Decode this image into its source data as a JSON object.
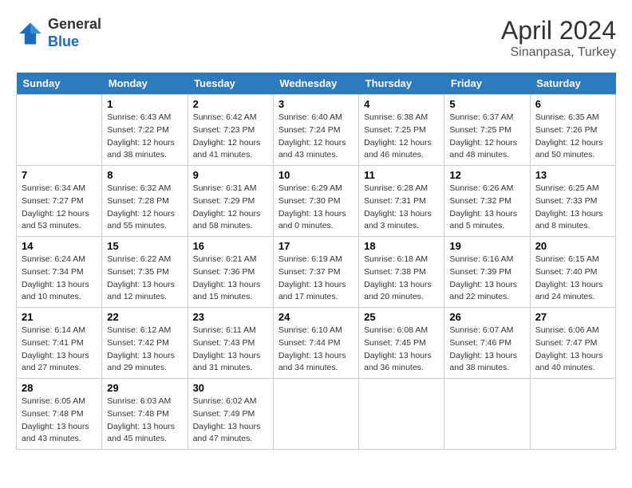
{
  "header": {
    "logo_line1": "General",
    "logo_line2": "Blue",
    "month_year": "April 2024",
    "location": "Sinanpasa, Turkey"
  },
  "days_of_week": [
    "Sunday",
    "Monday",
    "Tuesday",
    "Wednesday",
    "Thursday",
    "Friday",
    "Saturday"
  ],
  "weeks": [
    [
      {
        "day": "",
        "info": ""
      },
      {
        "day": "1",
        "info": "Sunrise: 6:43 AM\nSunset: 7:22 PM\nDaylight: 12 hours\nand 38 minutes."
      },
      {
        "day": "2",
        "info": "Sunrise: 6:42 AM\nSunset: 7:23 PM\nDaylight: 12 hours\nand 41 minutes."
      },
      {
        "day": "3",
        "info": "Sunrise: 6:40 AM\nSunset: 7:24 PM\nDaylight: 12 hours\nand 43 minutes."
      },
      {
        "day": "4",
        "info": "Sunrise: 6:38 AM\nSunset: 7:25 PM\nDaylight: 12 hours\nand 46 minutes."
      },
      {
        "day": "5",
        "info": "Sunrise: 6:37 AM\nSunset: 7:25 PM\nDaylight: 12 hours\nand 48 minutes."
      },
      {
        "day": "6",
        "info": "Sunrise: 6:35 AM\nSunset: 7:26 PM\nDaylight: 12 hours\nand 50 minutes."
      }
    ],
    [
      {
        "day": "7",
        "info": "Sunrise: 6:34 AM\nSunset: 7:27 PM\nDaylight: 12 hours\nand 53 minutes."
      },
      {
        "day": "8",
        "info": "Sunrise: 6:32 AM\nSunset: 7:28 PM\nDaylight: 12 hours\nand 55 minutes."
      },
      {
        "day": "9",
        "info": "Sunrise: 6:31 AM\nSunset: 7:29 PM\nDaylight: 12 hours\nand 58 minutes."
      },
      {
        "day": "10",
        "info": "Sunrise: 6:29 AM\nSunset: 7:30 PM\nDaylight: 13 hours\nand 0 minutes."
      },
      {
        "day": "11",
        "info": "Sunrise: 6:28 AM\nSunset: 7:31 PM\nDaylight: 13 hours\nand 3 minutes."
      },
      {
        "day": "12",
        "info": "Sunrise: 6:26 AM\nSunset: 7:32 PM\nDaylight: 13 hours\nand 5 minutes."
      },
      {
        "day": "13",
        "info": "Sunrise: 6:25 AM\nSunset: 7:33 PM\nDaylight: 13 hours\nand 8 minutes."
      }
    ],
    [
      {
        "day": "14",
        "info": "Sunrise: 6:24 AM\nSunset: 7:34 PM\nDaylight: 13 hours\nand 10 minutes."
      },
      {
        "day": "15",
        "info": "Sunrise: 6:22 AM\nSunset: 7:35 PM\nDaylight: 13 hours\nand 12 minutes."
      },
      {
        "day": "16",
        "info": "Sunrise: 6:21 AM\nSunset: 7:36 PM\nDaylight: 13 hours\nand 15 minutes."
      },
      {
        "day": "17",
        "info": "Sunrise: 6:19 AM\nSunset: 7:37 PM\nDaylight: 13 hours\nand 17 minutes."
      },
      {
        "day": "18",
        "info": "Sunrise: 6:18 AM\nSunset: 7:38 PM\nDaylight: 13 hours\nand 20 minutes."
      },
      {
        "day": "19",
        "info": "Sunrise: 6:16 AM\nSunset: 7:39 PM\nDaylight: 13 hours\nand 22 minutes."
      },
      {
        "day": "20",
        "info": "Sunrise: 6:15 AM\nSunset: 7:40 PM\nDaylight: 13 hours\nand 24 minutes."
      }
    ],
    [
      {
        "day": "21",
        "info": "Sunrise: 6:14 AM\nSunset: 7:41 PM\nDaylight: 13 hours\nand 27 minutes."
      },
      {
        "day": "22",
        "info": "Sunrise: 6:12 AM\nSunset: 7:42 PM\nDaylight: 13 hours\nand 29 minutes."
      },
      {
        "day": "23",
        "info": "Sunrise: 6:11 AM\nSunset: 7:43 PM\nDaylight: 13 hours\nand 31 minutes."
      },
      {
        "day": "24",
        "info": "Sunrise: 6:10 AM\nSunset: 7:44 PM\nDaylight: 13 hours\nand 34 minutes."
      },
      {
        "day": "25",
        "info": "Sunrise: 6:08 AM\nSunset: 7:45 PM\nDaylight: 13 hours\nand 36 minutes."
      },
      {
        "day": "26",
        "info": "Sunrise: 6:07 AM\nSunset: 7:46 PM\nDaylight: 13 hours\nand 38 minutes."
      },
      {
        "day": "27",
        "info": "Sunrise: 6:06 AM\nSunset: 7:47 PM\nDaylight: 13 hours\nand 40 minutes."
      }
    ],
    [
      {
        "day": "28",
        "info": "Sunrise: 6:05 AM\nSunset: 7:48 PM\nDaylight: 13 hours\nand 43 minutes."
      },
      {
        "day": "29",
        "info": "Sunrise: 6:03 AM\nSunset: 7:48 PM\nDaylight: 13 hours\nand 45 minutes."
      },
      {
        "day": "30",
        "info": "Sunrise: 6:02 AM\nSunset: 7:49 PM\nDaylight: 13 hours\nand 47 minutes."
      },
      {
        "day": "",
        "info": ""
      },
      {
        "day": "",
        "info": ""
      },
      {
        "day": "",
        "info": ""
      },
      {
        "day": "",
        "info": ""
      }
    ]
  ]
}
